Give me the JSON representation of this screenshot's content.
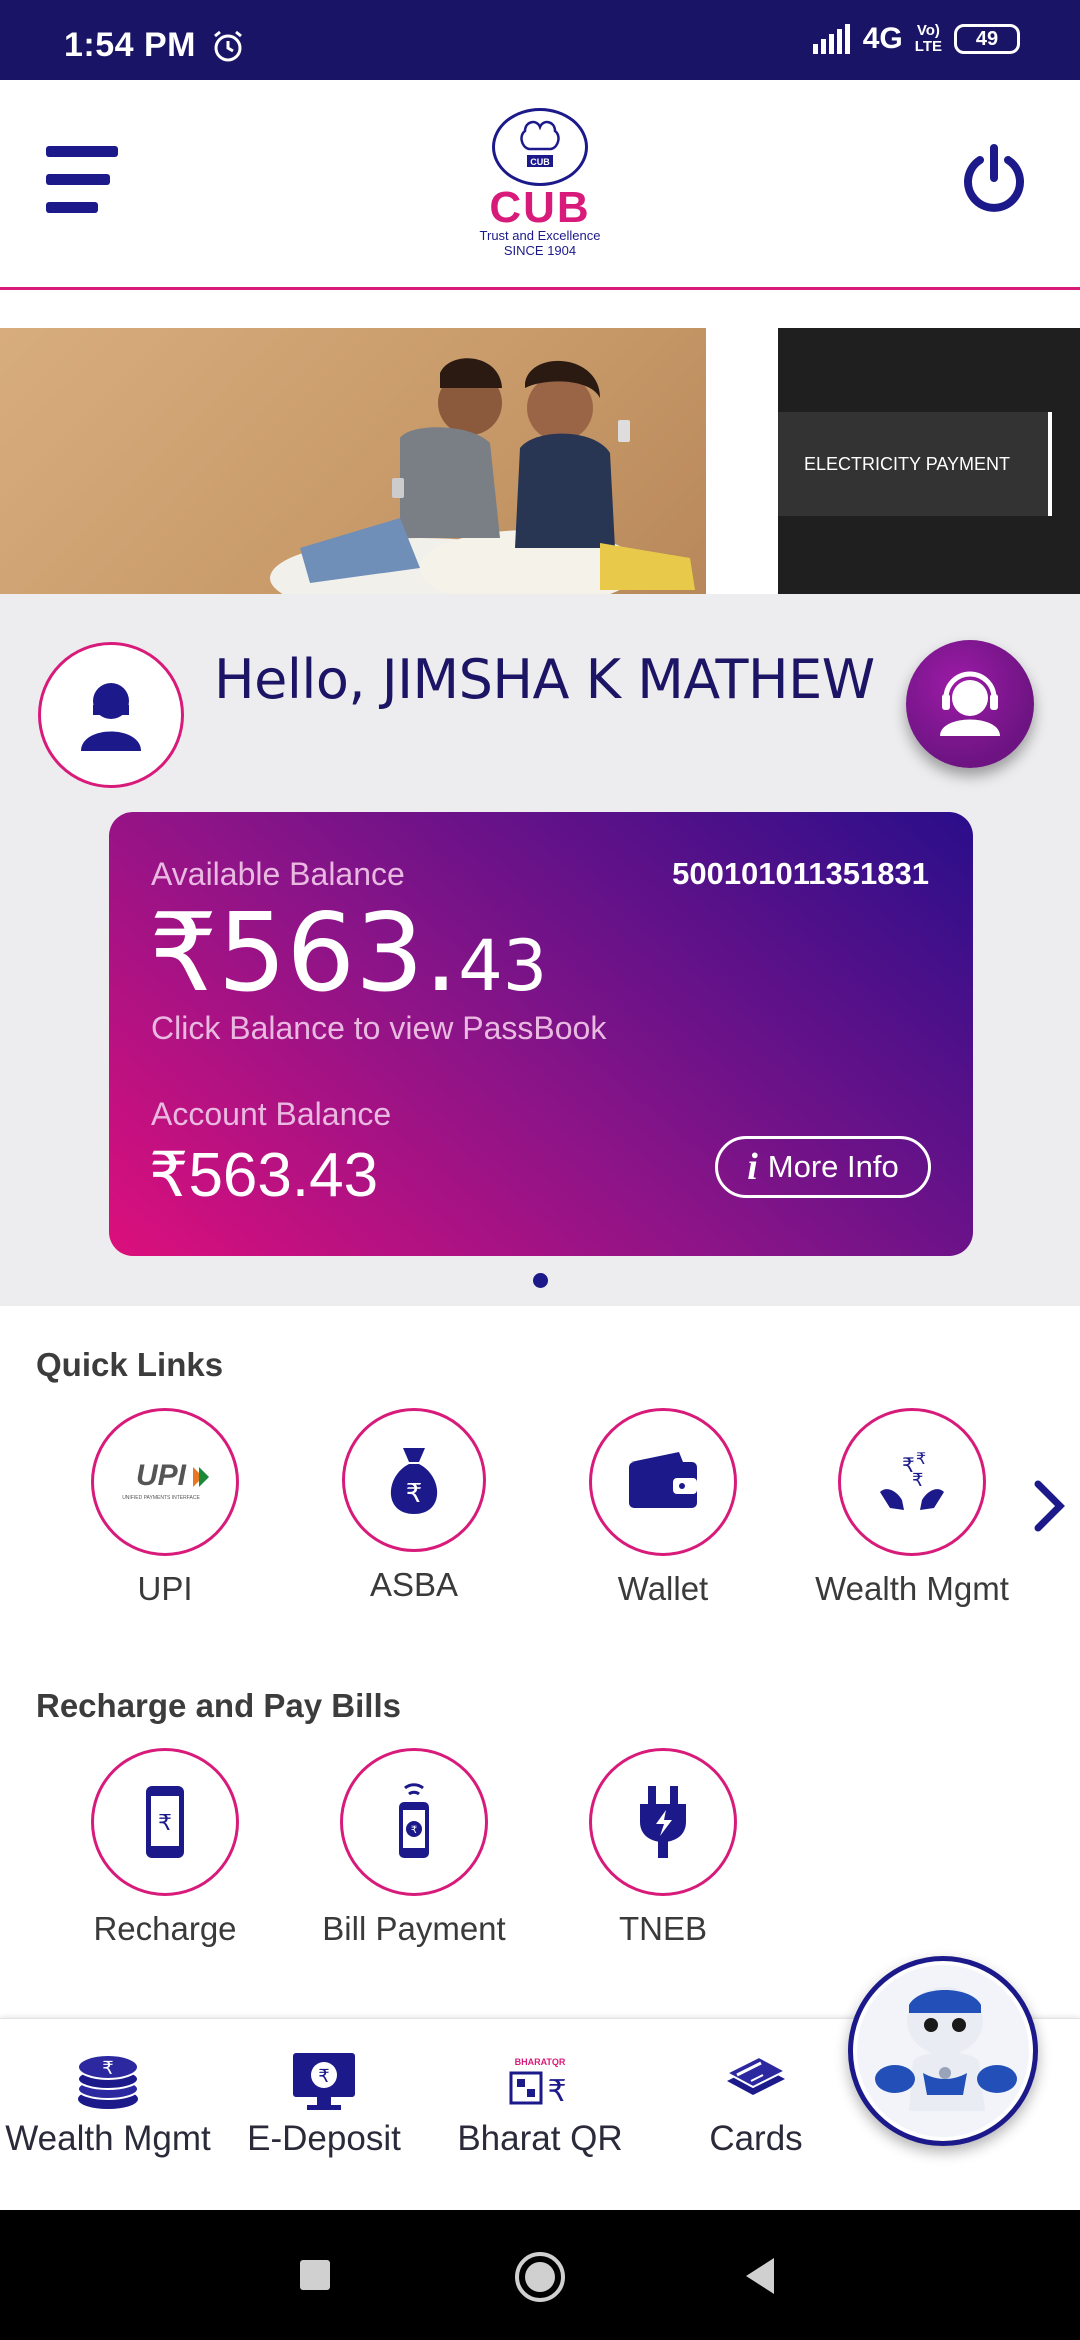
{
  "status_bar": {
    "time": "1:54 PM",
    "network": "4G",
    "volte_top": "Vo)",
    "volte_bottom": "LTE",
    "battery": "49"
  },
  "header": {
    "menu_icon": "hamburger-menu-icon",
    "logo_text": "CUB",
    "logo_tagline": "Trust and Excellence",
    "logo_since": "SINCE 1904",
    "power_icon": "power-icon"
  },
  "banners": [
    {
      "type": "photo",
      "icon": "two-men-with-phones-photo"
    },
    {
      "type": "tag",
      "text": "ELECTRICITY PAYMENT"
    }
  ],
  "greeting": {
    "text": "Hello, JIMSHA K MATHEW",
    "avatar_icon": "user-avatar-icon",
    "support_icon": "customer-support-headset-icon"
  },
  "balance_card": {
    "available_label": "Available Balance",
    "account_number": "500101011351831",
    "available_int": "₹563.",
    "available_dec": "43",
    "passbook_hint": "Click Balance to view PassBook",
    "account_balance_label": "Account Balance",
    "account_balance": "₹563.43",
    "more_info_label": "More Info",
    "more_info_glyph": "i"
  },
  "quick_links": {
    "title": "Quick Links",
    "items": [
      {
        "label": "UPI",
        "icon": "upi-logo-icon"
      },
      {
        "label": "ASBA",
        "icon": "rupee-money-bag-icon"
      },
      {
        "label": "Wallet",
        "icon": "wallet-icon"
      },
      {
        "label": "Wealth Mgmt",
        "icon": "rupee-hands-icon"
      }
    ],
    "upi_text": "UPI",
    "upi_sub": "UNIFIED PAYMENTS INTERFACE"
  },
  "recharge": {
    "title": "Recharge and Pay Bills",
    "items": [
      {
        "label": "Recharge",
        "icon": "mobile-rupee-icon"
      },
      {
        "label": "Bill Payment",
        "icon": "mobile-bill-icon"
      },
      {
        "label": "TNEB",
        "icon": "electric-plug-icon"
      }
    ]
  },
  "bottom_nav": [
    {
      "label": "Wealth Mgmt",
      "icon": "rupee-coins-stack-icon"
    },
    {
      "label": "E-Deposit",
      "icon": "monitor-rupee-icon"
    },
    {
      "label": "Bharat QR",
      "icon": "bharat-qr-icon",
      "badge": "BHARATQR"
    },
    {
      "label": "Cards",
      "icon": "cards-stack-icon"
    }
  ],
  "assistant_icon": "robot-assistant-icon",
  "colors": {
    "navy": "#1c1a8a",
    "magenta": "#d81b7a",
    "status_bar": "#1a1466"
  }
}
